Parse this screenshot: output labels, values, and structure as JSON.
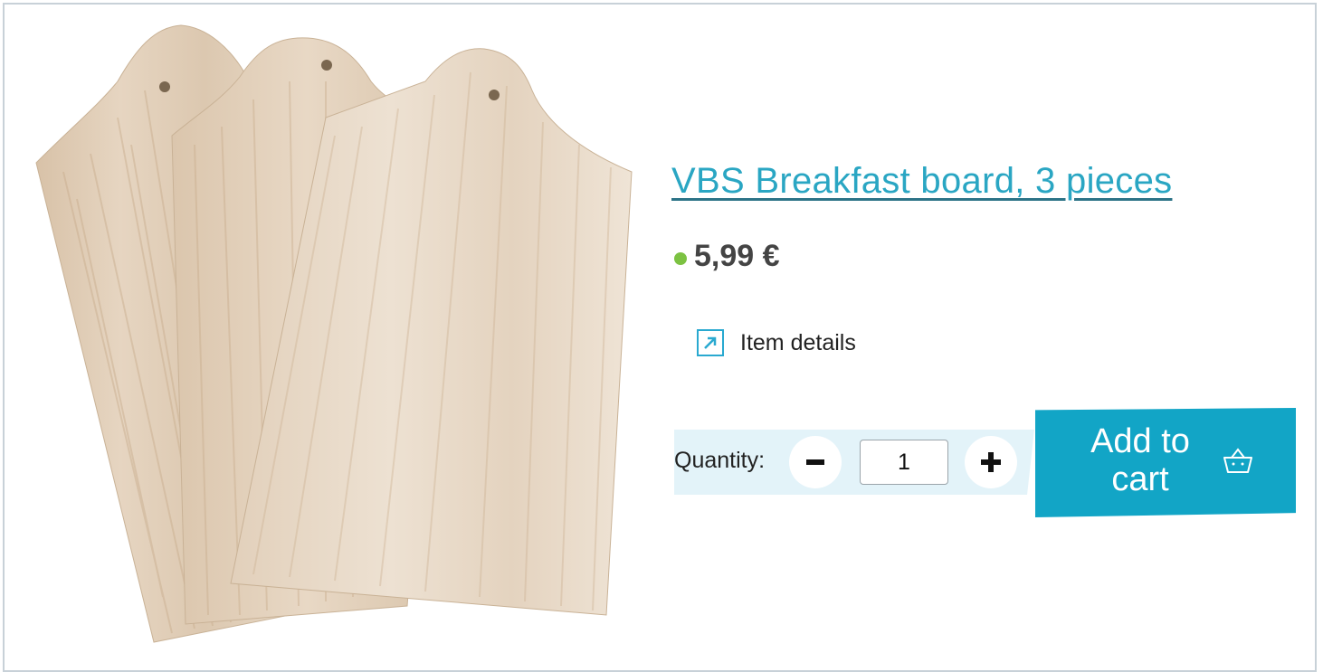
{
  "product": {
    "title": "VBS Breakfast board, 3 pieces",
    "price": "5,99 €",
    "stock_status_color": "#7cc242",
    "image_alt": "wooden-breakfast-boards-image"
  },
  "details": {
    "label": "Item details",
    "icon": "external-arrow-icon"
  },
  "quantity": {
    "label": "Quantity:",
    "value": "1"
  },
  "cart": {
    "label": "Add to cart",
    "icon": "basket-icon"
  },
  "colors": {
    "accent": "#12a5c6",
    "link": "#2aa6c3",
    "qty_panel": "#e3f3f9"
  }
}
